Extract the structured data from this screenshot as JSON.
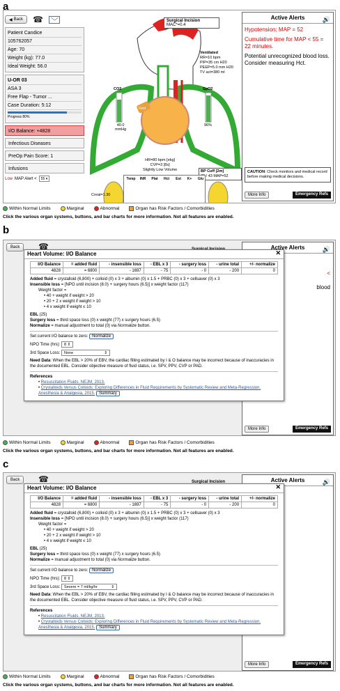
{
  "labels": {
    "a": "a",
    "b": "b",
    "c": "c"
  },
  "nav": {
    "back": "Back"
  },
  "patient": {
    "name": "Patient Candice",
    "id": "105762057",
    "age": "Age: 70",
    "weight": "Weight (kg): 77.0",
    "ideal": "Ideal Weight: 56.0"
  },
  "case": {
    "or": "U-OR 03",
    "asa": "ASA 3",
    "procedure": "Free Flap - Tumor ...",
    "duration": "Case Duration: 5:12",
    "progress": "Progress 80%",
    "progress_value": 0.8
  },
  "buttons": {
    "io": "I/O Balance: +4828",
    "infectious": "Infectious Diseases",
    "preop": "PreOp Pain Score: 1",
    "infusions": "Infusions"
  },
  "map_alert": {
    "low": "Low",
    "label": "MAP Alert <",
    "value": "55"
  },
  "body": {
    "surgical_title": "Surgical Incision",
    "mac": "MAC*=0.4",
    "vent_title": "Ventilated",
    "rr": "RR=10 bpm",
    "pip": "PIP=35 cm H20",
    "peep": "PEEP=5.0 mm H20",
    "tv": "TV act=380 ml",
    "co2_label": "CO2",
    "co2_val": "40.0",
    "co2_unit": "mmHg",
    "spo2_label": "SpO2",
    "spo2_val": "96%",
    "fent": "Fent",
    "hr": "HR=80 bpm [ekg]",
    "cvp": "CVP=3 [8s]",
    "volume": "Slightly Low Volume",
    "bp_title": "BP Cuff [2m]",
    "bp_val": "70 / 43 MAP=52",
    "creat": "Creat=1.30",
    "creat_time": "[54m]",
    "urine": "200 ml",
    "urine_rate": "35 ml/hr",
    "urine_rate2": ".3 ml/kg/hr"
  },
  "labs": [
    {
      "name": "Temp",
      "t1": "37",
      "t2": "36",
      "t3": "35",
      "val": "37.1",
      "time": ""
    },
    {
      "name": "INR",
      "t1": "1.5",
      "t2": "1.0",
      "t3": "",
      "val": "1.2",
      "time": "[2d]"
    },
    {
      "name": "Plat",
      "t1": "450",
      "t2": "150",
      "t3": "",
      "val": "180",
      "time": "[2d]"
    },
    {
      "name": "Hct",
      "t1": "50",
      "t2": "30",
      "t3": "",
      "val": "40",
      "time": "[2h]"
    },
    {
      "name": "Est",
      "t1": "",
      "t2": "",
      "t3": "",
      "val": "30",
      "time": "[2h]"
    },
    {
      "name": "K+",
      "t1": "5",
      "t2": "3",
      "t3": "",
      "val": "4.0",
      "time": "[2h]"
    },
    {
      "name": "Glu",
      "t1": "200",
      "t2": "70",
      "t3": "",
      "val": "170",
      "time": "[2h]"
    }
  ],
  "alerts": {
    "title": "Active Alerts",
    "hypo": "Hypotension: MAP = 52",
    "cumulative": "Cumulative time for MAP < 55 = 22 minutes.",
    "message": "Potential unrecognized blood loss. Consider measuring Hct.",
    "caution_bold": "CAUTION",
    "caution": ": Check monitors and medical record before making medical decisions.",
    "more": "More Info",
    "emergency": "Emergency Refs",
    "partial": "blood",
    "lt": "<"
  },
  "legend": {
    "wnl": "Within Normal Limits",
    "marginal": "Marginal",
    "abnormal": "Abnormal",
    "risk": "Organ has Risk Factors / Comorbidities"
  },
  "note": "Click the various organ systems, buttons, and bar charts for more information. Not all features are enabled.",
  "modal": {
    "title": "Heart Volume: I/O Balance",
    "headers": [
      "I/O Balance",
      "= added fluid",
      "- insensible loss",
      "- EBL x 3",
      "- surgery loss",
      "- urine total",
      "+/- normalize"
    ],
    "values": [
      "4828",
      "= 6800",
      "- 1697",
      "- 75",
      "- 0",
      "- 200",
      "0"
    ],
    "added_b": "Added fluid",
    "added": " = crystalloid (6,800) + colloid (0) x 3 + albumin (0) x 1.5 + PRBC (0) x 3 + cellsaver (0) x 3",
    "insens_b": "Insensible loss",
    "insens_b_text": " = [NPO until incision (8.0) + surgery hours (6.5)] x weight factor (117)",
    "insens_c_text": " = [NPO until incision (8.0) + surgery hours (6.5)] x weight factor (117)",
    "wf": "Weight factor =",
    "wf1": "40 + weight if weight > 20",
    "wf2": "20 + 2 x weight if weight > 10",
    "wf3": "4 x weight if weight ≤ 10",
    "ebl": "EBL",
    "ebl_v": " (25)",
    "surgery_b": "Surgery loss",
    "surgery": " = third space loss (0) x weight (77) x surgery hours (6.5)",
    "norm_b": "Normalize",
    "norm1": " = manual adjustment to total (0) via ",
    "norm_i": "Normalize",
    "norm2": " button.",
    "set_zero": "Set current I/O balance to zero:",
    "normalize_btn": "Normalize",
    "npo_label": "NPO Time (hrs):",
    "npo_val": "8",
    "third_label": "3rd Space Loss:",
    "third_b": "None",
    "third_c": "Severe = 7 ml/kg/hr",
    "need_b": "Need Data",
    "need": ": When the EBL > 20% of EBV, the cardiac filling estimated by I & O balance may be incorrect because of inaccuracies in the documented EBL. Consider objective measure of fluid status, i.e. SPV, PPV, CVP or PAD.",
    "refs": "References",
    "ref1": "Resuscitation Fluids. NEJM, 2013.",
    "ref2": "Crystalloids Versus Colloids: Exploring Differences in Fluid Requirements by Systematic Review and Meta-Regression. Anesthesia & Analgesia, 2015.",
    "summary": "Summary"
  }
}
